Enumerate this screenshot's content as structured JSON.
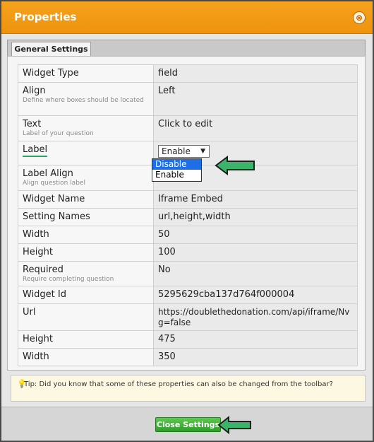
{
  "dialog": {
    "title": "Properties",
    "close_icon": "⊗"
  },
  "tabs": [
    {
      "label": "General Settings"
    }
  ],
  "properties": [
    {
      "label": "Widget Type",
      "value": "field"
    },
    {
      "label": "Align",
      "desc": "Define where boxes should be located",
      "value": "Left"
    },
    {
      "label": "Text",
      "desc": "Label of your question",
      "value": "Click to edit"
    },
    {
      "label": "Label",
      "value": "Enable"
    },
    {
      "label": "Label Align",
      "desc": "Align question label",
      "value": ""
    },
    {
      "label": "Widget Name",
      "value": "Iframe Embed"
    },
    {
      "label": "Setting Names",
      "value": "url,height,width"
    },
    {
      "label": "Width",
      "value": "50"
    },
    {
      "label": "Height",
      "value": "100"
    },
    {
      "label": "Required",
      "desc": "Require completing question",
      "value": "No"
    },
    {
      "label": "Widget Id",
      "value": "5295629cba137d764f000004"
    },
    {
      "label": "Url",
      "value": "https://doublethedonation.com/api/iframe/Nvg=false"
    },
    {
      "label": "Height",
      "value": "475"
    },
    {
      "label": "Width",
      "value": "350"
    }
  ],
  "label_dropdown": {
    "selected": "Enable",
    "caret": "▼",
    "options": [
      "Disable",
      "Enable"
    ],
    "highlighted": "Disable"
  },
  "tip": {
    "icon": "lightbulb-icon",
    "text": "Tip: Did you know that some of these properties can also be changed from the toolbar?"
  },
  "footer": {
    "close_label": "Close Settings"
  },
  "colors": {
    "titlebar": "#f39c12",
    "accent_green": "#2e9d2a",
    "highlight_blue": "#1e6ee6"
  }
}
